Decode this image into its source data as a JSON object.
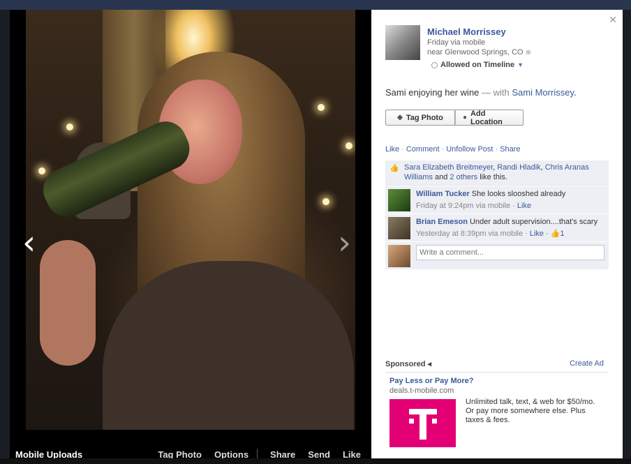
{
  "photo_viewer": {
    "album": "Mobile Uploads",
    "actions": [
      "Tag Photo",
      "Options",
      "Share",
      "Send",
      "Like"
    ],
    "prev_icon": "chevron-left-icon",
    "next_icon": "chevron-right-icon"
  },
  "post": {
    "author": "Michael Morrissey",
    "time_source": "Friday via mobile",
    "location": "near Glenwood Springs, CO",
    "privacy": "Allowed on Timeline",
    "caption_text": "Sami enjoying her wine",
    "caption_with": " — with ",
    "caption_tagged": "Sami Morrissey",
    "caption_end": ".",
    "buttons": {
      "tag_photo": "Tag Photo",
      "add_location": "Add Location"
    },
    "actions": [
      "Like",
      "Comment",
      "Unfollow Post",
      "Share"
    ]
  },
  "likes": {
    "names": [
      "Sara Elizabeth Breitmeyer",
      "Randi Hladik",
      "Chris Aranas Williams"
    ],
    "sep1": ", ",
    "sep2": ", ",
    "and": " and ",
    "others": "2 others",
    "suffix": " like this."
  },
  "comments": [
    {
      "name": "William Tucker",
      "text": " She looks slooshed already",
      "meta": "Friday at 9:24pm via mobile · ",
      "like": "Like",
      "like_count": ""
    },
    {
      "name": "Brian Emeson",
      "text": " Under adult supervision....that's scary",
      "meta": "Yesterday at 8:39pm via mobile · ",
      "like": "Like",
      "like_count": " · 👍1"
    }
  ],
  "comment_input": {
    "placeholder": "Write a comment..."
  },
  "sponsored": {
    "label": "Sponsored",
    "create_ad": "Create Ad",
    "ad_title": "Pay Less or Pay More?",
    "ad_domain": "deals.t-mobile.com",
    "ad_body": "Unlimited talk, text, & web for $50/mo. Or pay more somewhere else. Plus taxes & fees."
  },
  "colors": {
    "link": "#3b5998",
    "ufi_bg": "#edeff4",
    "tmobile": "#e20074"
  }
}
